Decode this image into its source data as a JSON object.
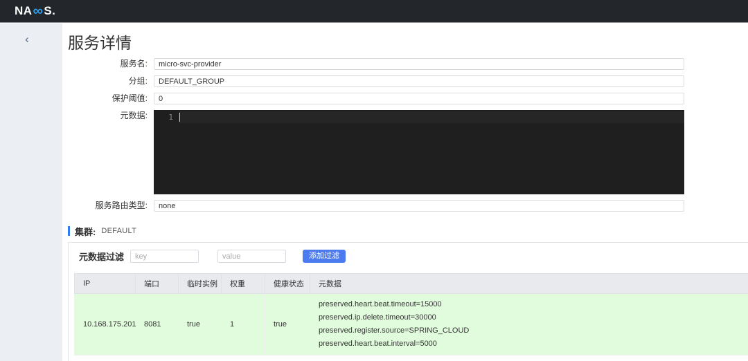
{
  "brand": {
    "logo_prefix": "NA",
    "logo_infinity": "∞",
    "logo_suffix": "S.",
    "logo_accent_color": "#2aa3f4",
    "topbar_color": "#23272b"
  },
  "nav": {
    "back_icon": "‹"
  },
  "page": {
    "title": "服务详情"
  },
  "form": {
    "service_name": {
      "label": "服务名:",
      "value": "micro-svc-provider"
    },
    "group": {
      "label": "分组:",
      "value": "DEFAULT_GROUP"
    },
    "protect_threshold": {
      "label": "保护阈值:",
      "value": "0"
    },
    "metadata": {
      "label": "元数据:",
      "line_number": "1",
      "content": ""
    },
    "route_type": {
      "label": "服务路由类型:",
      "value": "none"
    }
  },
  "cluster": {
    "label": "集群:",
    "name": "DEFAULT",
    "accent_color": "#2e7ef2",
    "filter": {
      "label": "元数据过滤",
      "key_placeholder": "key",
      "value_placeholder": "value",
      "add_button_label": "添加过滤",
      "add_button_color": "#4c7bf0"
    },
    "table": {
      "columns": [
        "IP",
        "端口",
        "临时实例",
        "权重",
        "健康状态",
        "元数据"
      ],
      "healthy_row_color": "#e1fcdc",
      "rows": [
        {
          "ip": "10.168.175.201",
          "port": "8081",
          "ephemeral": "true",
          "weight": "1",
          "healthy": "true",
          "metadata": [
            "preserved.heart.beat.timeout=15000",
            "preserved.ip.delete.timeout=30000",
            "preserved.register.source=SPRING_CLOUD",
            "preserved.heart.beat.interval=5000"
          ]
        }
      ]
    }
  }
}
